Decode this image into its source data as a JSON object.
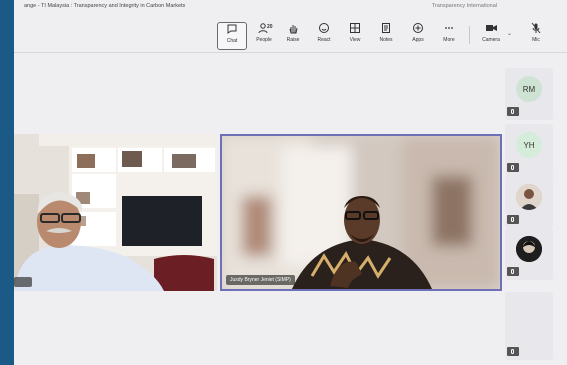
{
  "window": {
    "title": "ange - TI Malaysia : Transparency and Integrity in Carbon Markets",
    "title_right": "Transparency International"
  },
  "toolbar": {
    "chat": "Chat",
    "people": "People",
    "people_count": "20",
    "raise": "Raise",
    "react": "React",
    "view": "View",
    "notes": "Notes",
    "apps": "Apps",
    "more": "More",
    "camera": "Camera",
    "mic": "Mic"
  },
  "tiles": [
    {
      "name": ""
    },
    {
      "name": "Jusdy Bryner Jeniet (SIMP)"
    }
  ],
  "rail": [
    {
      "initials": "RM",
      "color": "#cfe3d4"
    },
    {
      "initials": "YH",
      "color": "#d4ecd9"
    },
    {
      "initials": "",
      "color": "#c9b8a8"
    },
    {
      "initials": "",
      "color": "#2a2a2a"
    },
    {
      "initials": "",
      "color": "#e8e8ec"
    }
  ]
}
